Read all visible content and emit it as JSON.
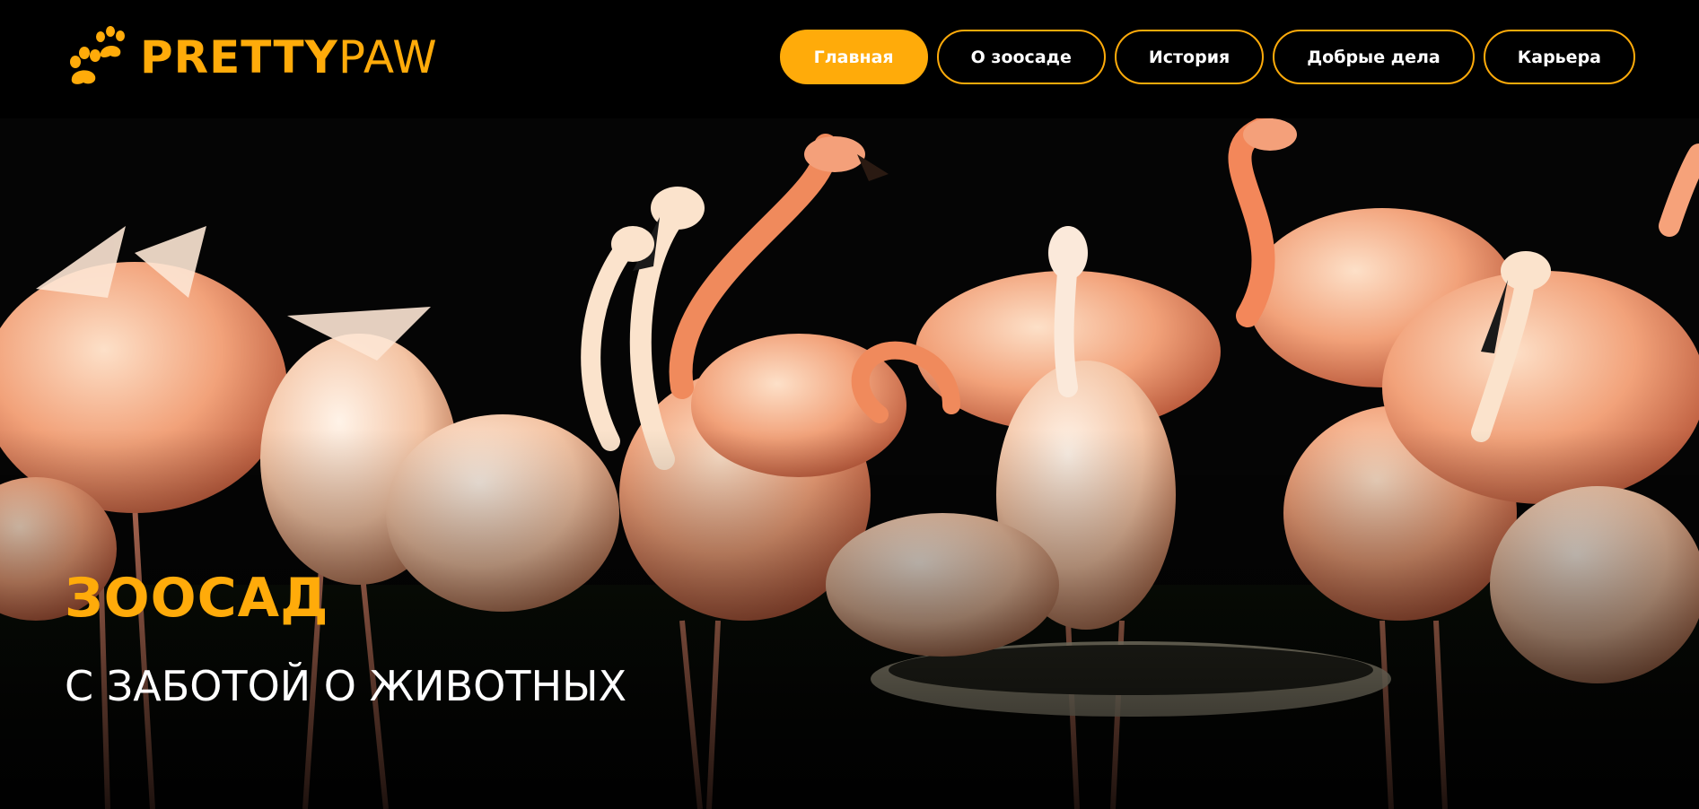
{
  "brand": {
    "name_bold": "PRETTY",
    "name_light": "PAW",
    "logo_icon": "paw-print-icon"
  },
  "nav": {
    "items": [
      {
        "label": "Главная",
        "active": true
      },
      {
        "label": "О зоосаде",
        "active": false
      },
      {
        "label": "История",
        "active": false
      },
      {
        "label": "Добрые дела",
        "active": false
      },
      {
        "label": "Карьера",
        "active": false
      }
    ]
  },
  "hero": {
    "title": "ЗООСАД",
    "subtitle": "С ЗАБОТОЙ О ЖИВОТНЫХ",
    "image": "flamingo-flock-photo"
  },
  "colors": {
    "accent": "#ffab0a",
    "background": "#000000",
    "text": "#ffffff"
  }
}
